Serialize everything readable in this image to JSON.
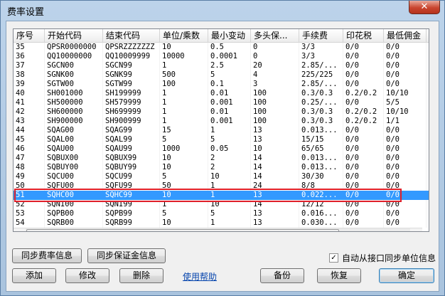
{
  "window": {
    "title": "费率设置",
    "close_label": "✕"
  },
  "table": {
    "headers": [
      "序号",
      "开始代码",
      "结束代码",
      "单位/乘数",
      "最小变动",
      "多头保...",
      "手续费",
      "印花税",
      "最低佣金"
    ],
    "rows": [
      [
        "35",
        "QPSR0000000",
        "QPSRZZZZZZZ",
        "10",
        "0.5",
        "0",
        "3/3",
        "0/0",
        "0/0"
      ],
      [
        "36",
        "QQ10000000",
        "QQ10009999",
        "10000",
        "0.0001",
        "0",
        "3/3",
        "0/0",
        "0/0"
      ],
      [
        "37",
        "SGCN00",
        "SGCN99",
        "1",
        "2.5",
        "20",
        "2.85/...",
        "0/0",
        "0/0"
      ],
      [
        "38",
        "SGNK00",
        "SGNK99",
        "500",
        "5",
        "4",
        "225/225",
        "0/0",
        "0/0"
      ],
      [
        "39",
        "SGTW00",
        "SGTW99",
        "100",
        "0.1",
        "3",
        "2.85/...",
        "0/0",
        "0/0"
      ],
      [
        "40",
        "SH001000",
        "SH199999",
        "1",
        "0.01",
        "100",
        "0.3/0.3",
        "0.2/0.2",
        "10/10"
      ],
      [
        "41",
        "SH500000",
        "SH579999",
        "1",
        "0.001",
        "100",
        "0.25/...",
        "0/0",
        "5/5"
      ],
      [
        "42",
        "SH600000",
        "SH699999",
        "1",
        "0.01",
        "100",
        "0.3/0.3",
        "0.2/0.2",
        "10/10"
      ],
      [
        "43",
        "SH900000",
        "SH900999",
        "1",
        "0.001",
        "100",
        "0.3/0.3",
        "0.2/0.2",
        "1/1"
      ],
      [
        "44",
        "SQAG00",
        "SQAG99",
        "15",
        "1",
        "13",
        "0.013...",
        "0/0",
        "0/0"
      ],
      [
        "45",
        "SQAL00",
        "SQAL99",
        "5",
        "5",
        "13",
        "15/15",
        "0/0",
        "0/0"
      ],
      [
        "46",
        "SQAU00",
        "SQAU99",
        "1000",
        "0.05",
        "10",
        "65/65",
        "0/0",
        "0/0"
      ],
      [
        "47",
        "SQBUX00",
        "SQBUX99",
        "10",
        "2",
        "14",
        "0.013...",
        "0/0",
        "0/0"
      ],
      [
        "48",
        "SQBUY00",
        "SQBUY99",
        "10",
        "2",
        "14",
        "0.013...",
        "0/0",
        "0/0"
      ],
      [
        "49",
        "SQCU00",
        "SQCU99",
        "5",
        "10",
        "14",
        "30/30",
        "0/0",
        "0/0"
      ],
      [
        "50",
        "SQFU00",
        "SQFU99",
        "50",
        "1",
        "24",
        "8/8",
        "0/0",
        "0/0"
      ],
      [
        "51",
        "SQHC00",
        "SQHC99",
        "10",
        "1",
        "13",
        "0.022...",
        "0/0",
        "0/0"
      ],
      [
        "52",
        "SQNI00",
        "SQNI99",
        "1",
        "10",
        "14",
        "12/12",
        "0/0",
        "0/0"
      ],
      [
        "53",
        "SQPB00",
        "SQPB99",
        "5",
        "5",
        "13",
        "0.016...",
        "0/0",
        "0/0"
      ],
      [
        "54",
        "SQRB00",
        "SQRB99",
        "10",
        "1",
        "13",
        "0.030...",
        "0/0",
        "0/0"
      ]
    ],
    "selected_row": 16
  },
  "buttons": {
    "sync_rate": "同步费率信息",
    "sync_margin": "同步保证金信息",
    "add": "添加",
    "edit": "修改",
    "delete": "删除",
    "help": "使用帮助",
    "backup": "备份",
    "restore": "恢复",
    "ok": "确定"
  },
  "options": {
    "auto_sync_label": "自动从接口同步单位信息",
    "auto_sync_checked": true,
    "check_mark": "✓"
  },
  "scroll": {
    "up": "▲",
    "down": "▼",
    "left": "◀",
    "right": "▶"
  },
  "colors": {
    "selection": "#3399ff",
    "highlight_border": "#e0202a",
    "link": "#0645ad"
  }
}
